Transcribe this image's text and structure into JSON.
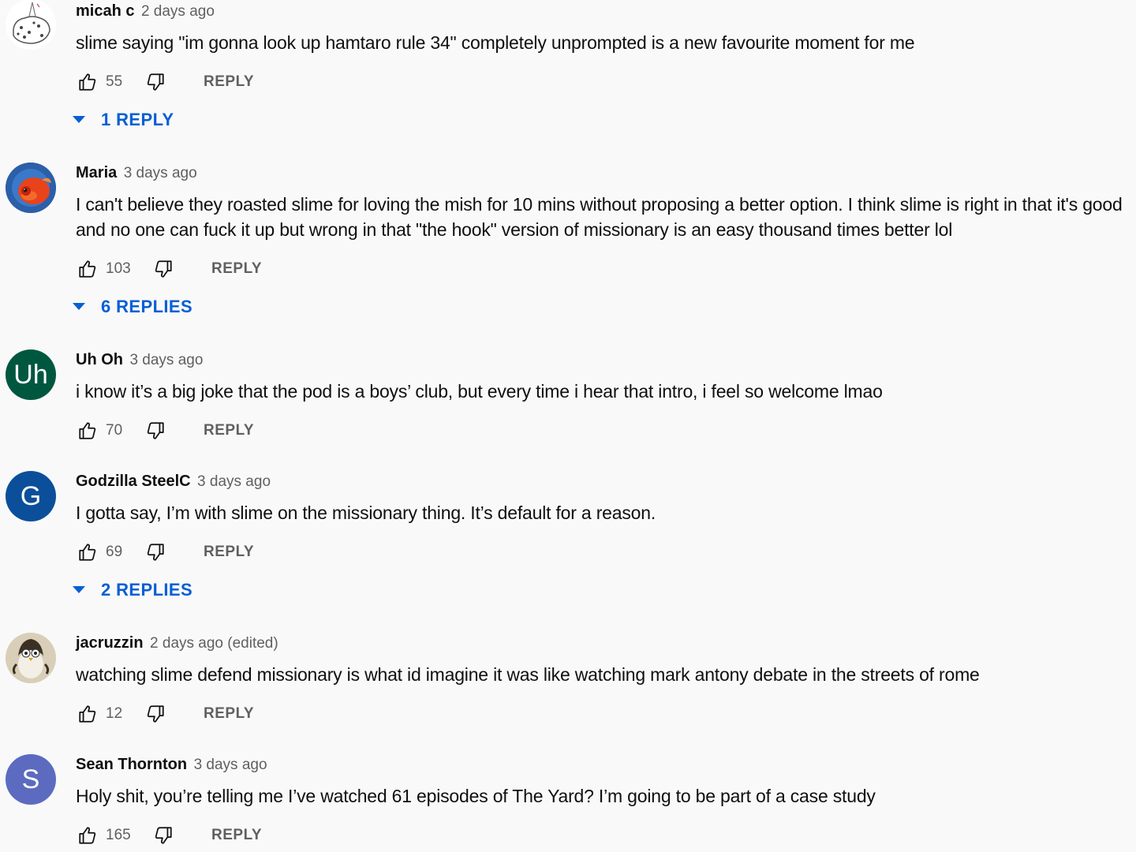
{
  "comments": [
    {
      "author": "micah c",
      "time": "2 days ago",
      "text": "slime saying \"im gonna look up hamtaro rule 34\" completely unprompted is a new favourite moment for me",
      "likes": "55",
      "reply_label": "REPLY",
      "replies_label": "1 REPLY",
      "avatar": {
        "type": "drawing-cake",
        "color": "#ffffff"
      }
    },
    {
      "author": "Maria",
      "time": "3 days ago",
      "text": "I can't believe they roasted slime for loving the mish for 10 mins without proposing a better option. I think slime is right in that it's good and no one can fuck it up but wrong in that \"the hook\" version of missionary is an easy thousand times better lol",
      "likes": "103",
      "reply_label": "REPLY",
      "replies_label": "6 REPLIES",
      "avatar": {
        "type": "photo-goldfish",
        "color": "#2b5fa8"
      }
    },
    {
      "author": "Uh Oh",
      "time": "3 days ago",
      "text": "i know it’s a big joke that the pod is a boys’ club, but every time i hear that intro, i feel so welcome lmao",
      "likes": "70",
      "reply_label": "REPLY",
      "avatar": {
        "type": "initials",
        "initials": "Uh",
        "color": "#00573f"
      }
    },
    {
      "author": "Godzilla SteelC",
      "time": "3 days ago",
      "text": "I gotta say, I’m with slime on the missionary thing. It’s default for a reason.",
      "likes": "69",
      "reply_label": "REPLY",
      "replies_label": "2 REPLIES",
      "avatar": {
        "type": "initials",
        "initials": "G",
        "color": "#0b4f9a"
      }
    },
    {
      "author": "jacruzzin",
      "time": "2 days ago (edited)",
      "text": "watching slime defend missionary is what id imagine it was like watching mark antony debate in the streets of rome",
      "likes": "12",
      "reply_label": "REPLY",
      "avatar": {
        "type": "photo-penguin",
        "color": "#d9cfb8"
      }
    },
    {
      "author": "Sean Thornton",
      "time": "3 days ago",
      "text": "Holy shit, you’re telling me I’ve watched 61 episodes of The Yard? I’m going to be part of a case study",
      "likes": "165",
      "reply_label": "REPLY",
      "avatar": {
        "type": "initials",
        "initials": "S",
        "color": "#5c6bc0"
      }
    }
  ],
  "colors": {
    "background": "#f9f9f9",
    "text_primary": "#0f0f0f",
    "text_secondary": "#606060",
    "link_blue": "#065fd4"
  }
}
